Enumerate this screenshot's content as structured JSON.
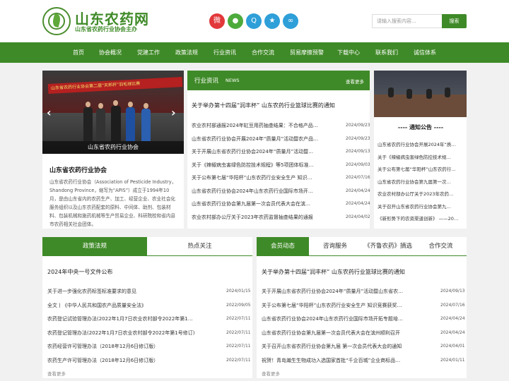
{
  "header": {
    "site_name": "山东农药网",
    "site_sub": "山东省农药行业协会主办",
    "social": [
      "weibo-icon",
      "wechat-icon",
      "qq-icon",
      "star-icon",
      "link-icon"
    ],
    "social_colors": [
      "#e2383a",
      "#4dab3c",
      "#2e9fd8",
      "#2e9fd8",
      "#2e9fd8"
    ],
    "search_placeholder": "请输入搜索内容...",
    "search_button": "搜索"
  },
  "nav": [
    "首页",
    "协会概况",
    "党建工作",
    "政策法规",
    "行业资讯",
    "合作交流",
    "贸易摩擦预警",
    "下载中心",
    "联系我们",
    "诚信体系"
  ],
  "banner": {
    "slogan": "山东省农药行业协会第二届“天邦杯”羽毛球比赛",
    "caption": "山东省农药行业协会"
  },
  "about": {
    "title": "山东省农药行业协会",
    "text": "山东省农药行业协会（Association of Pesticide Industry，Shandong Province，缩写为“APIS”）成立于1994年10月，是由山东省内的农药生产、加工、经营企业、农业社会化服务组织以及山东农药配套的原料、中间体、助剂、包装材料、包装机械和施药机械等生产贸易企业、科研院校和省内县市农药相关社会团体。"
  },
  "industry_news": {
    "title": "行业资讯",
    "title_en": "NEWS",
    "more": "查看更多",
    "lead": "关于举办第十四届“润丰杯” 山东农药行业篮球比赛的通知",
    "items": [
      {
        "title": "农业农村部通报2024年缸豆用药抽查结果：不合格产品…",
        "date": "2024/09/23"
      },
      {
        "title": "山东省农药行业协会开展2024年“质量月”活动暨农产品…",
        "date": "2024/09/23"
      },
      {
        "title": "关于开展山东省农药行业协会2024年“质量月”活动暨…",
        "date": "2024/09/13"
      },
      {
        "title": "关于《辣椒病虫害绿色防控技术规程》等5项团体标准…",
        "date": "2024/09/03"
      },
      {
        "title": "关于公布第七届“华阳杯”山东农药行业安全生产 知识…",
        "date": "2024/07/16"
      },
      {
        "title": "山东省农药行业协会2024年山东农药行业国际市场开…",
        "date": "2024/04/24"
      },
      {
        "title": "山东省农药行业协会第九届第一次会员代表大会在滨…",
        "date": "2024/04/24"
      },
      {
        "title": "农业农村部办公厅关于2023年农药监督抽查结果的通报",
        "date": "2024/04/02"
      }
    ]
  },
  "notice": {
    "title": "---- 通知公告 ----",
    "items": [
      "山东省农药行业协会开展2024年“质…",
      "关于《辣椒病虫害绿色防控技术规…",
      "关于公布第七届“华阳杯”山东农药行…",
      "山东省农药行业协会第九届第一次…",
      "农业农村部办公厅关于2023年农药…",
      "关于召开山东省农药行业协会第九…",
      "《新形势下的农资渠道创新》 ——20…"
    ]
  },
  "policy": {
    "tabs": [
      "政策法规",
      "热点关注"
    ],
    "lead": "2024年中央一号文件公布",
    "more": "查看更多",
    "items": [
      {
        "title": "关于进一步强化农药标签标准要求的意见",
        "date": "2024/01/15"
      },
      {
        "title": "全文丨《中华人民共和国农产品质量安全法》",
        "date": "2022/09/05"
      },
      {
        "title": "农药登记试验管理办法(2022年1月7日农业农村部令2022年第1…",
        "date": "2022/07/11"
      },
      {
        "title": "农药登记管理办法(2022年1月7日农业农村部令2022年第1号修订)",
        "date": "2022/07/11"
      },
      {
        "title": "农药经营许可管理办法（2018年12月6日修订版）",
        "date": "2022/07/11"
      },
      {
        "title": "农药生产许可管理办法（2018年12月6日修订版）",
        "date": "2022/07/11"
      }
    ]
  },
  "members": {
    "tabs": [
      "会员动态",
      "咨询服务",
      "《齐鲁农药》摘选",
      "合作交流"
    ],
    "lead": "关于举办第十四届“润丰杯” 山东农药行业篮球比赛的通知",
    "more": "查看更多",
    "items": [
      {
        "title": "关于开展山东省农药行业协会2024年“质量月”活动暨山东省农…",
        "date": "2024/09/13"
      },
      {
        "title": "关于公布第七届“华阳杯”山东农药行业安全生产 知识竞赛获奖…",
        "date": "2024/07/16"
      },
      {
        "title": "山东省农药行业协会2024年山东农药行业国际市场开拓专题培…",
        "date": "2024/04/24"
      },
      {
        "title": "山东省农药行业协会第九届第一次会员代表大会在滨州顺利召开",
        "date": "2024/04/24"
      },
      {
        "title": "关于召开山东省农药行业协会第九届 第一次会员代表大会的通知",
        "date": "2024/04/01"
      },
      {
        "title": "祝贺！青岛瀚生生物成功入选国家首批“千企百城”企业商标品…",
        "date": "2024/01/11"
      }
    ]
  },
  "colors": {
    "brand_green": "#3f8a28"
  }
}
